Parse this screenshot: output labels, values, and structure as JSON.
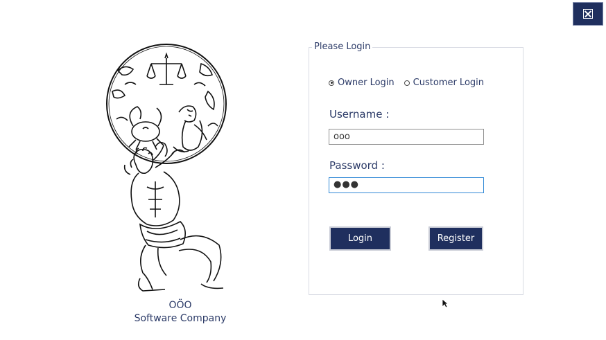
{
  "window": {
    "close_icon": "close-box-icon"
  },
  "company": {
    "logo_text": "OÖO",
    "name": "Software Company",
    "logo_icon": "atlas-holding-zodiac-globe"
  },
  "login": {
    "group_title": "Please Login",
    "login_types": [
      {
        "label": "Owner Login",
        "checked": true
      },
      {
        "label": "Customer Login",
        "checked": false
      }
    ],
    "username_label": "Username :",
    "username_value": "ooo",
    "password_label": "Password :",
    "password_value": "●●●",
    "login_button": "Login",
    "register_button": "Register"
  },
  "colors": {
    "accent": "#1f2f5e",
    "text": "#2b3a67",
    "focus_border": "#2f88d6"
  }
}
